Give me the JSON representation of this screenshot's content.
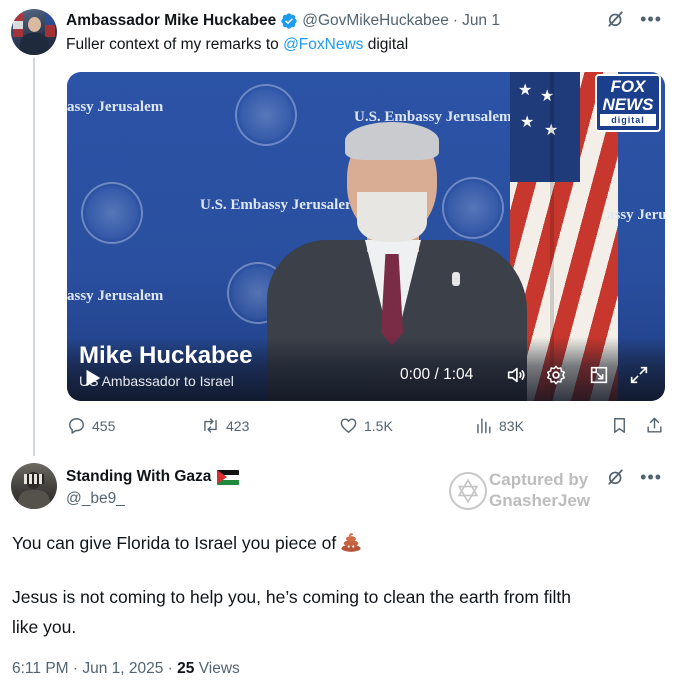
{
  "tweet1": {
    "author_name": "Ambassador Mike Huckabee",
    "handle": "@GovMikeHuckabee",
    "separator": "·",
    "date": "Jun 1",
    "text_before": "Fuller context of my remarks to ",
    "mention": "@FoxNews",
    "text_after": " digital",
    "video": {
      "watermarks": [
        "assy Jerusalem",
        "U.S. Embassy Jerusalem",
        "U.S. Embassy Jerusaler",
        "assy Jerusalem",
        "assy Jeru"
      ],
      "fox_logo": {
        "line1": "FOX",
        "line2": "NEWS",
        "line3": "digital"
      },
      "lower_third_name": "Mike Huckabee",
      "lower_third_title": "US Ambassador to Israel",
      "time": "0:00 / 1:04"
    },
    "stats": {
      "replies": "455",
      "reposts": "423",
      "likes": "1.5K",
      "views": "83K"
    }
  },
  "tweet2": {
    "author_name": "Standing With Gaza",
    "handle": "@_be9_",
    "watermark": {
      "line1": "Captured by",
      "line2": "GnasherJew"
    },
    "line1": "You can give Florida to Israel you piece of",
    "line2": "Jesus is not coming to help you, he’s coming to clean the earth from filth",
    "line3": "like you.",
    "timestamp": "6:11 PM · Jun 1, 2025 · ",
    "views_count": "25",
    "views_label": " Views"
  },
  "colors": {
    "accent": "#1d9bf0",
    "muted": "#536471",
    "text": "#0f1419",
    "thread_line": "#cfd9de"
  },
  "icons": [
    "verified-badge-icon",
    "grok-icon",
    "more-icon",
    "play-icon",
    "volume-icon",
    "settings-icon",
    "pip-icon",
    "fullscreen-icon",
    "reply-icon",
    "repost-icon",
    "like-icon",
    "views-icon",
    "bookmark-icon",
    "share-icon",
    "palestine-flag-icon",
    "poop-emoji-icon",
    "star-of-david-logo"
  ]
}
